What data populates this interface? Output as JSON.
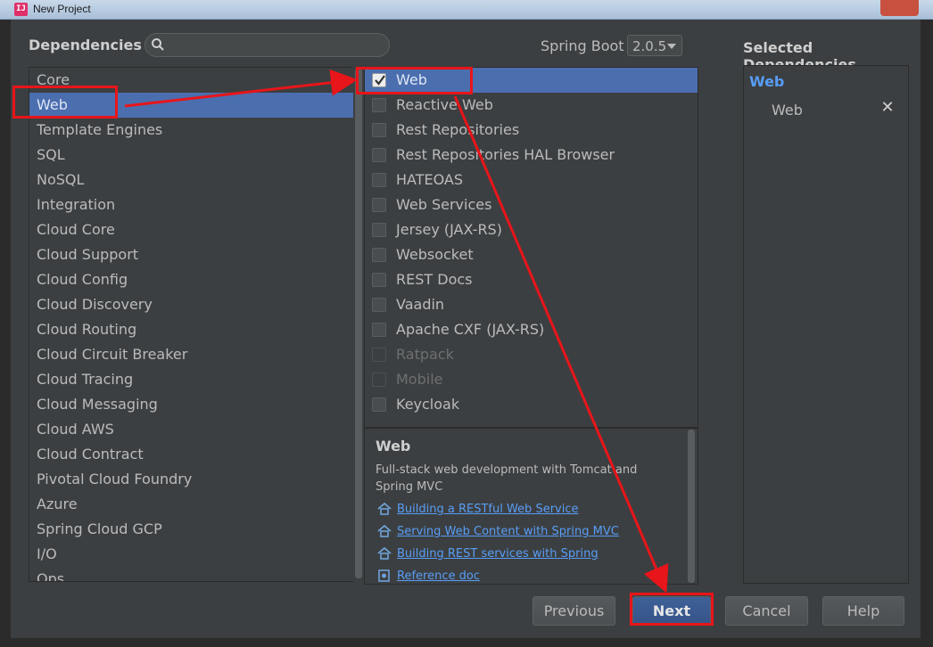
{
  "window": {
    "title": "New Project"
  },
  "header": {
    "dependencies_label": "Dependencies",
    "search_value": "",
    "spring_boot_label": "Spring Boot",
    "spring_boot_version": "2.0.5",
    "selected_label": "Selected Dependencies"
  },
  "categories": [
    {
      "label": "Core",
      "selected": false
    },
    {
      "label": "Web",
      "selected": true
    },
    {
      "label": "Template Engines",
      "selected": false
    },
    {
      "label": "SQL",
      "selected": false
    },
    {
      "label": "NoSQL",
      "selected": false
    },
    {
      "label": "Integration",
      "selected": false
    },
    {
      "label": "Cloud Core",
      "selected": false
    },
    {
      "label": "Cloud Support",
      "selected": false
    },
    {
      "label": "Cloud Config",
      "selected": false
    },
    {
      "label": "Cloud Discovery",
      "selected": false
    },
    {
      "label": "Cloud Routing",
      "selected": false
    },
    {
      "label": "Cloud Circuit Breaker",
      "selected": false
    },
    {
      "label": "Cloud Tracing",
      "selected": false
    },
    {
      "label": "Cloud Messaging",
      "selected": false
    },
    {
      "label": "Cloud AWS",
      "selected": false
    },
    {
      "label": "Cloud Contract",
      "selected": false
    },
    {
      "label": "Pivotal Cloud Foundry",
      "selected": false
    },
    {
      "label": "Azure",
      "selected": false
    },
    {
      "label": "Spring Cloud GCP",
      "selected": false
    },
    {
      "label": "I/O",
      "selected": false
    },
    {
      "label": "Ops",
      "selected": false
    }
  ],
  "dependencies": [
    {
      "label": "Web",
      "checked": true,
      "selected": true,
      "disabled": false
    },
    {
      "label": "Reactive Web",
      "checked": false,
      "selected": false,
      "disabled": false
    },
    {
      "label": "Rest Repositories",
      "checked": false,
      "selected": false,
      "disabled": false
    },
    {
      "label": "Rest Repositories HAL Browser",
      "checked": false,
      "selected": false,
      "disabled": false
    },
    {
      "label": "HATEOAS",
      "checked": false,
      "selected": false,
      "disabled": false
    },
    {
      "label": "Web Services",
      "checked": false,
      "selected": false,
      "disabled": false
    },
    {
      "label": "Jersey (JAX-RS)",
      "checked": false,
      "selected": false,
      "disabled": false
    },
    {
      "label": "Websocket",
      "checked": false,
      "selected": false,
      "disabled": false
    },
    {
      "label": "REST Docs",
      "checked": false,
      "selected": false,
      "disabled": false
    },
    {
      "label": "Vaadin",
      "checked": false,
      "selected": false,
      "disabled": false
    },
    {
      "label": "Apache CXF (JAX-RS)",
      "checked": false,
      "selected": false,
      "disabled": false
    },
    {
      "label": "Ratpack",
      "checked": false,
      "selected": false,
      "disabled": true
    },
    {
      "label": "Mobile",
      "checked": false,
      "selected": false,
      "disabled": true
    },
    {
      "label": "Keycloak",
      "checked": false,
      "selected": false,
      "disabled": false
    }
  ],
  "description": {
    "title": "Web",
    "text": "Full-stack web development with Tomcat and Spring MVC",
    "links": [
      {
        "label": "Building a RESTful Web Service",
        "icon": "home-icon"
      },
      {
        "label": "Serving Web Content with Spring MVC",
        "icon": "home-icon"
      },
      {
        "label": "Building REST services with Spring",
        "icon": "home-icon"
      },
      {
        "label": "Reference doc",
        "icon": "doc-icon"
      }
    ]
  },
  "selected": {
    "group": "Web",
    "items": [
      "Web"
    ]
  },
  "buttons": {
    "previous": "Previous",
    "next": "Next",
    "cancel": "Cancel",
    "help": "Help"
  },
  "colors": {
    "background": "#3c3f41",
    "selection": "#4b6eaf",
    "link": "#589df6",
    "annotation": "#e8151a"
  }
}
